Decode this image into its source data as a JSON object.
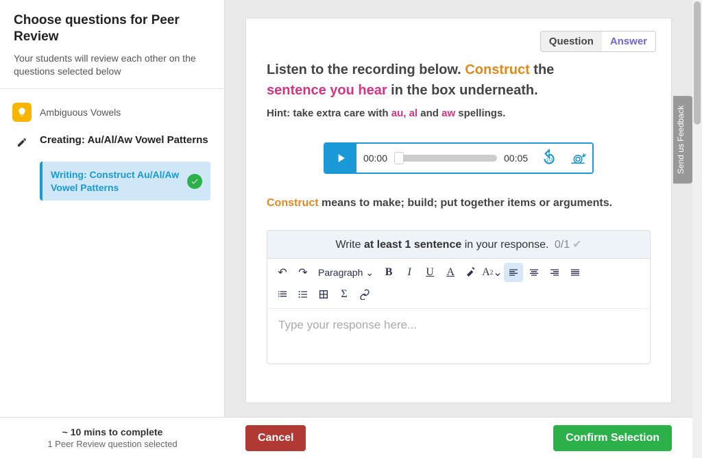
{
  "sidebar": {
    "title": "Choose questions for Peer Review",
    "subtitle": "Your students will review each other on the questions selected below",
    "lesson_label": "Ambiguous Vowels",
    "creating_label": "Creating: Au/Al/Aw Vowel Patterns",
    "writing_label": "Writing: Construct Au/Al/Aw Vowel Patterns"
  },
  "qa": {
    "question": "Question",
    "answer": "Answer"
  },
  "prompt": {
    "p1a": "Listen to the recording below. ",
    "p1b": "Construct",
    "p1c": " the ",
    "p2a": "sentence you hear",
    "p2b": " in the box underneath."
  },
  "hint": {
    "lead": "Hint: take extra care with ",
    "s1": "au, al",
    "mid": " and ",
    "s2": "aw",
    "tail": " spellings."
  },
  "audio": {
    "current": "00:00",
    "total": "00:05",
    "rewind": "10"
  },
  "definition": {
    "word": "Construct",
    "text": " means to make; build; put together items or arguments."
  },
  "response": {
    "lead": "Write ",
    "bold": "at least 1 sentence",
    "tail": " in your response. ",
    "count": "0/1"
  },
  "toolbar": {
    "paragraph": "Paragraph"
  },
  "editor": {
    "placeholder": "Type your response here..."
  },
  "footer": {
    "time": "~ 10 mins to complete",
    "selected": "1 Peer Review question selected",
    "cancel": "Cancel",
    "confirm": "Confirm Selection"
  },
  "feedback": "Send us Feedback"
}
